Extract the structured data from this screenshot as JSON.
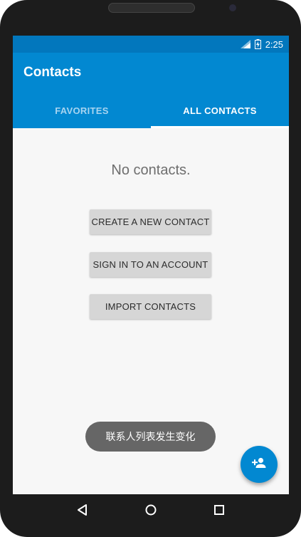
{
  "status_bar": {
    "time": "2:25",
    "signal_icon": "signal-icon",
    "battery_icon": "battery-charging-icon"
  },
  "app_bar": {
    "title": "Contacts",
    "color": "#0288d1"
  },
  "tabs": [
    {
      "label": "FAVORITES",
      "active": false
    },
    {
      "label": "ALL CONTACTS",
      "active": true
    }
  ],
  "content": {
    "empty_text": "No contacts.",
    "buttons": {
      "create": "CREATE A NEW CONTACT",
      "sign_in": "SIGN IN TO AN ACCOUNT",
      "import": "IMPORT CONTACTS"
    }
  },
  "toast": {
    "text": "联系人列表发生变化"
  },
  "fab": {
    "icon": "add-person-icon"
  },
  "nav_bar": {
    "back_icon": "back-icon",
    "home_icon": "home-icon",
    "recents_icon": "recents-icon"
  }
}
